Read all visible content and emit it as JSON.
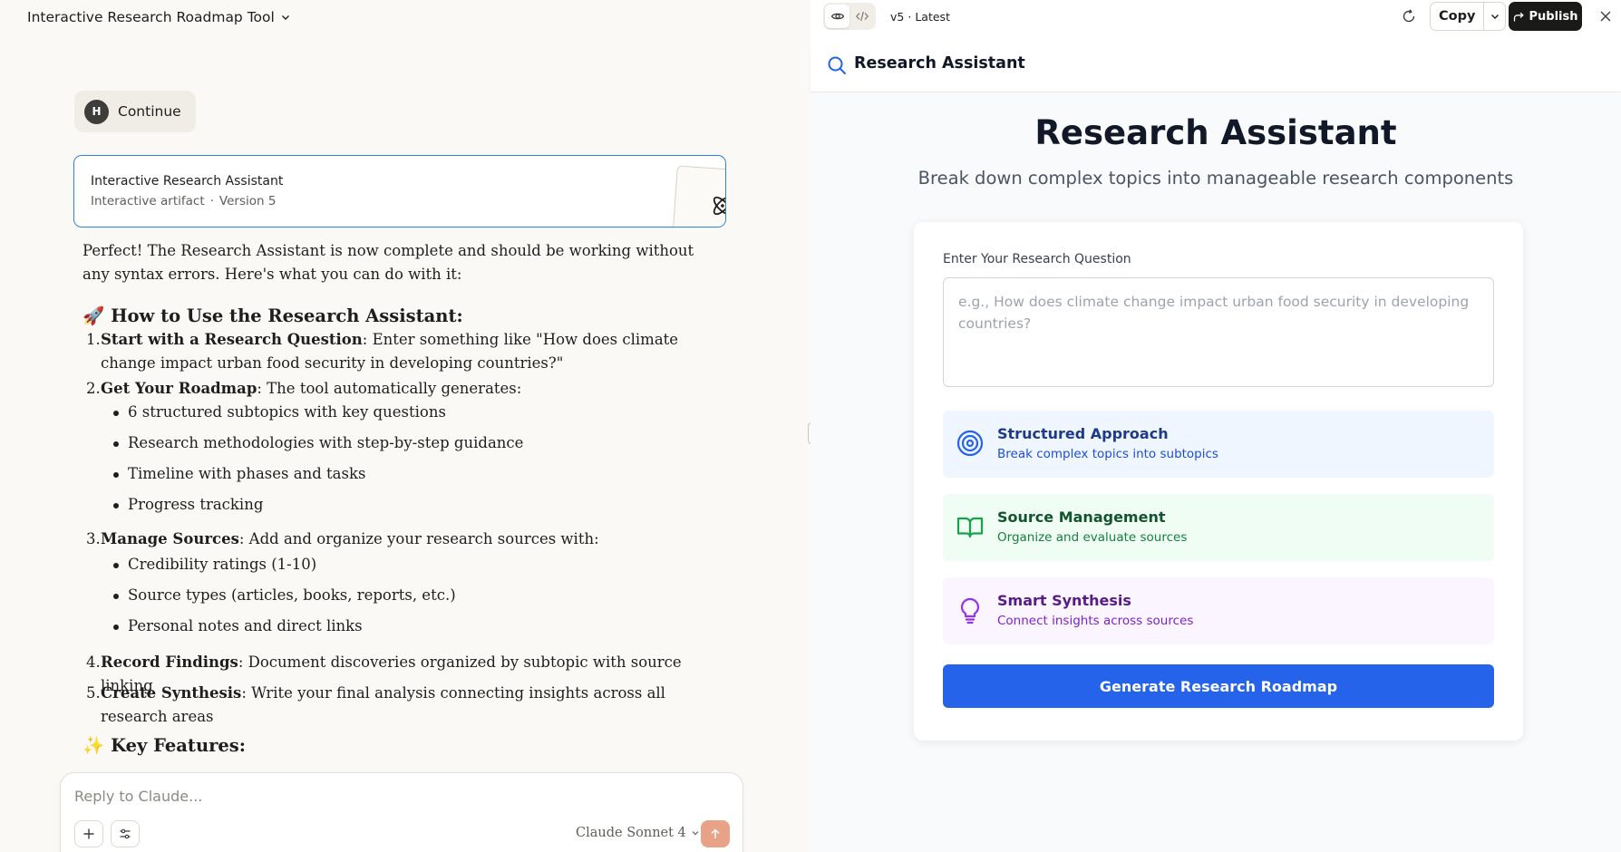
{
  "conversation": {
    "title": "Interactive Research Roadmap Tool"
  },
  "user_message": {
    "avatar_initial": "H",
    "text": "Continue"
  },
  "artifact_card": {
    "title": "Interactive Research Assistant",
    "type": "Interactive artifact",
    "separator": "·",
    "version": "Version 5"
  },
  "response": {
    "intro": "Perfect! The Research Assistant is now complete and should be working without any syntax errors. Here's what you can do with it:",
    "how_heading": "🚀 How to Use the Research Assistant:",
    "steps": [
      {
        "num": "1.",
        "bold": "Start with a Research Question",
        "text": ": Enter something like \"How does climate change impact urban food security in developing countries?\"",
        "bullets": []
      },
      {
        "num": "2.",
        "bold": "Get Your Roadmap",
        "text": ": The tool automatically generates:",
        "bullets": [
          "6 structured subtopics with key questions",
          "Research methodologies with step-by-step guidance",
          "Timeline with phases and tasks",
          "Progress tracking"
        ]
      },
      {
        "num": "3.",
        "bold": "Manage Sources",
        "text": ": Add and organize your research sources with:",
        "bullets": [
          "Credibility ratings (1-10)",
          "Source types (articles, books, reports, etc.)",
          "Personal notes and direct links"
        ]
      },
      {
        "num": "4.",
        "bold": "Record Findings",
        "text": ": Document discoveries organized by subtopic with source linking",
        "bullets": []
      },
      {
        "num": "5.",
        "bold": "Create Synthesis",
        "text": ": Write your final analysis connecting insights across all research areas",
        "bullets": []
      }
    ],
    "features_heading": "✨ Key Features:"
  },
  "composer": {
    "placeholder": "Reply to Claude...",
    "model": "Claude Sonnet 4"
  },
  "artifact_toolbar": {
    "version_label": "v5",
    "version_sep": "·",
    "version_status": "Latest",
    "copy_label": "Copy",
    "publish_label": "Publish"
  },
  "app": {
    "header_name": "Research Assistant",
    "hero_title": "Research Assistant",
    "hero_subtitle": "Break down complex topics into manageable research components",
    "question_label": "Enter Your Research Question",
    "question_placeholder": "e.g., How does climate change impact urban food security in developing countries?",
    "question_value": "",
    "features": [
      {
        "icon": "target-icon",
        "title": "Structured Approach",
        "desc": "Break complex topics into subtopics",
        "color": "#2563eb"
      },
      {
        "icon": "book-open-icon",
        "title": "Source Management",
        "desc": "Organize and evaluate sources",
        "color": "#16a34a"
      },
      {
        "icon": "lightbulb-icon",
        "title": "Smart Synthesis",
        "desc": "Connect insights across sources",
        "color": "#9333ea"
      }
    ],
    "generate_label": "Generate Research Roadmap"
  },
  "colors": {
    "accent_blue": "#2563eb",
    "publish_bg": "#1a1a19",
    "send_button": "#e8a287",
    "artifact_border": "#2c84db"
  }
}
